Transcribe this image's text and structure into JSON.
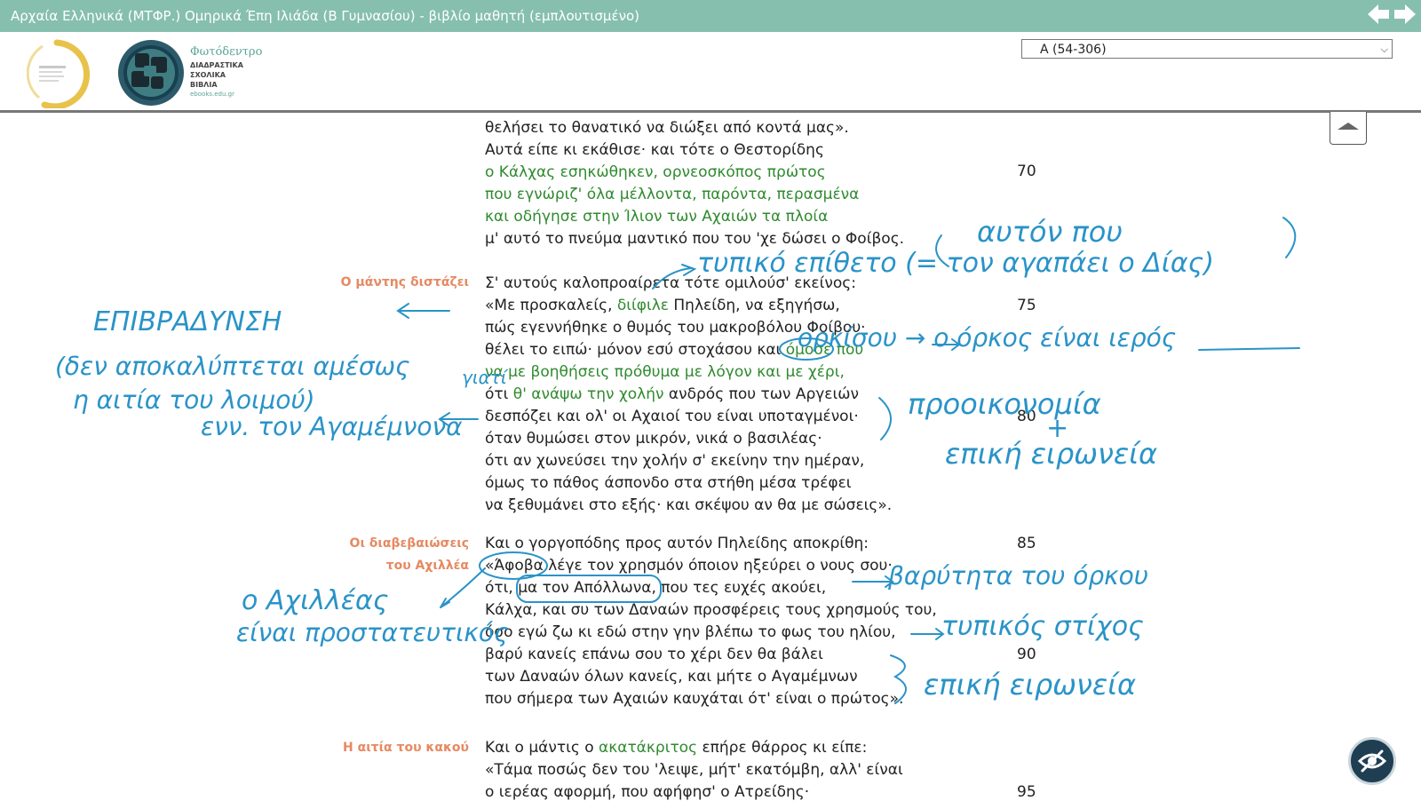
{
  "window": {
    "title": "Αρχαία Ελληνικά (ΜΤΦΡ.) Ομηρικά Έπη Ιλιάδα (Β Γυμνασίου) - βιβλίο μαθητή (εμπλουτισμένο)"
  },
  "brand": {
    "name": "Φωτόδεντρο",
    "subtitle": [
      "ΔΙΑΔΡΑΣΤΙΚΑ",
      "ΣΧΟΛΙΚΑ",
      "ΒΙΒΛΙΑ"
    ],
    "url": "ebooks.edu.gr"
  },
  "section_select": {
    "value": "Α (54-306)"
  },
  "colors": {
    "titlebar": "#86bfae",
    "green_text": "#2f8a2f",
    "side_heading": "#e58a62",
    "handwriting": "#2a93c8"
  },
  "side_headings": {
    "s1": "Ο μάντης διστάζει",
    "s2a": "Οι διαβεβαιώσεις",
    "s2b": "του Αχιλλέα",
    "s3": "Η αιτία του κακού"
  },
  "line_numbers": {
    "n70": "70",
    "n75": "75",
    "n80": "80",
    "n85": "85",
    "n90": "90",
    "n95": "95"
  },
  "verses": {
    "v1": "θελήσει το θανατικό να διώξει από κοντά μας».",
    "v2": "Αυτά είπε κι εκάθισε· και τότε ο Θεστορίδης",
    "v3": "ο Κάλχας εσηκώθηκεν, ορνεοσκόπος πρώτος",
    "v4": "που εγνώριζ' όλα μέλλοντα, παρόντα, περασμένα",
    "v5": "και οδήγησε στην Ίλιον των Αχαιών τα πλοία",
    "v6": "μ' αυτό το πνεύμα μαντικό που του 'χε δώσει ο Φοίβος.",
    "v7": "Σ' αυτούς καλοπροαίρετα τότε ομιλούσ' εκείνος:",
    "v8a": "«Με προσκαλείς, ",
    "v8b": "διίφιλε",
    "v8c": " Πηλείδη, να εξηγήσω,",
    "v9": "πώς εγεννήθηκε ο θυμός του μακροβόλου Φοίβου·",
    "v10a": "θέλει το ειπώ· μόνον εσύ στοχάσου και ",
    "v10b": "όμοσε που",
    "v11": "να με βοηθήσεις πρόθυμα με λόγον και με χέρι,",
    "v12a": "ότι ",
    "v12b": "θ' ανάψω την χολήν",
    "v12c": " ανδρός που των Αργειών",
    "v13": "δεσπόζει και ολ' οι Αχαιοί του είναι υποταγμένοι·",
    "v14": "όταν θυμώσει στον μικρόν, νικά ο βασιλέας·",
    "v15": "ότι αν χωνεύσει την χολήν σ' εκείνην την ημέραν,",
    "v16": "όμως το πάθος άσπονδο στα στήθη μέσα τρέφει",
    "v17": "να ξεθυμάνει στο εξής· και σκέψου αν θα με σώσεις».",
    "v18": "Και ο γοργοπόδης προς αυτόν Πηλείδης αποκρίθη:",
    "v19": "«Άφοβα λέγε τον χρησμόν όποιον ηξεύρει ο νους σου·",
    "v20": "ότι, μα τον Απόλλωνα, που τες ευχές ακούει,",
    "v21": "Κάλχα, και συ των Δαναών προσφέρεις τους χρησμούς του,",
    "v22": "όσο εγώ ζω κι εδώ στην γην βλέπω το φως του ηλίου,",
    "v23": "βαρύ κανείς επάνω σου το χέρι δεν θα βάλει",
    "v24": "των Δαναών όλων κανείς, και μήτε ο Αγαμέμνων",
    "v25": "που σήμερα των Αχαιών καυχάται ότ' είναι ο πρώτος».",
    "v26a": "Και ο μάντις ο ",
    "v26b": "ακατάκριτος",
    "v26c": " επήρε θάρρος κι είπε:",
    "v27": "«Τάμα ποσώς δεν του 'λειψε, μήτ' εκατόμβη, αλλ' είναι",
    "v28": "ο ιερέας αφορμή, που αφήφησ' ο Ατρείδης·"
  },
  "handwritten_notes": {
    "h1": "αυτόν που",
    "h2": "τυπικό επίθετο (= τον αγαπάει ο Δίας)",
    "h3": "ΕΠΙΒΡΑΔΥΝΣΗ",
    "h4": "(δεν αποκαλύπτεται αμέσως",
    "h5": "η αιτία του λοιμού)",
    "h6": "ενν. τον Αγαμέμνονα",
    "h7": "γιατί",
    "h8": "ορκίσου → ο όρκος είναι ιερός",
    "h9": "προοικονομία",
    "h10": "+",
    "h11": "επική ειρωνεία",
    "h12": "βαρύτητα του όρκου",
    "h13": "ο Αχιλλέας",
    "h14": "είναι προστατευτικός",
    "h15": "τυπικός στίχος",
    "h16": "επική ειρωνεία"
  }
}
